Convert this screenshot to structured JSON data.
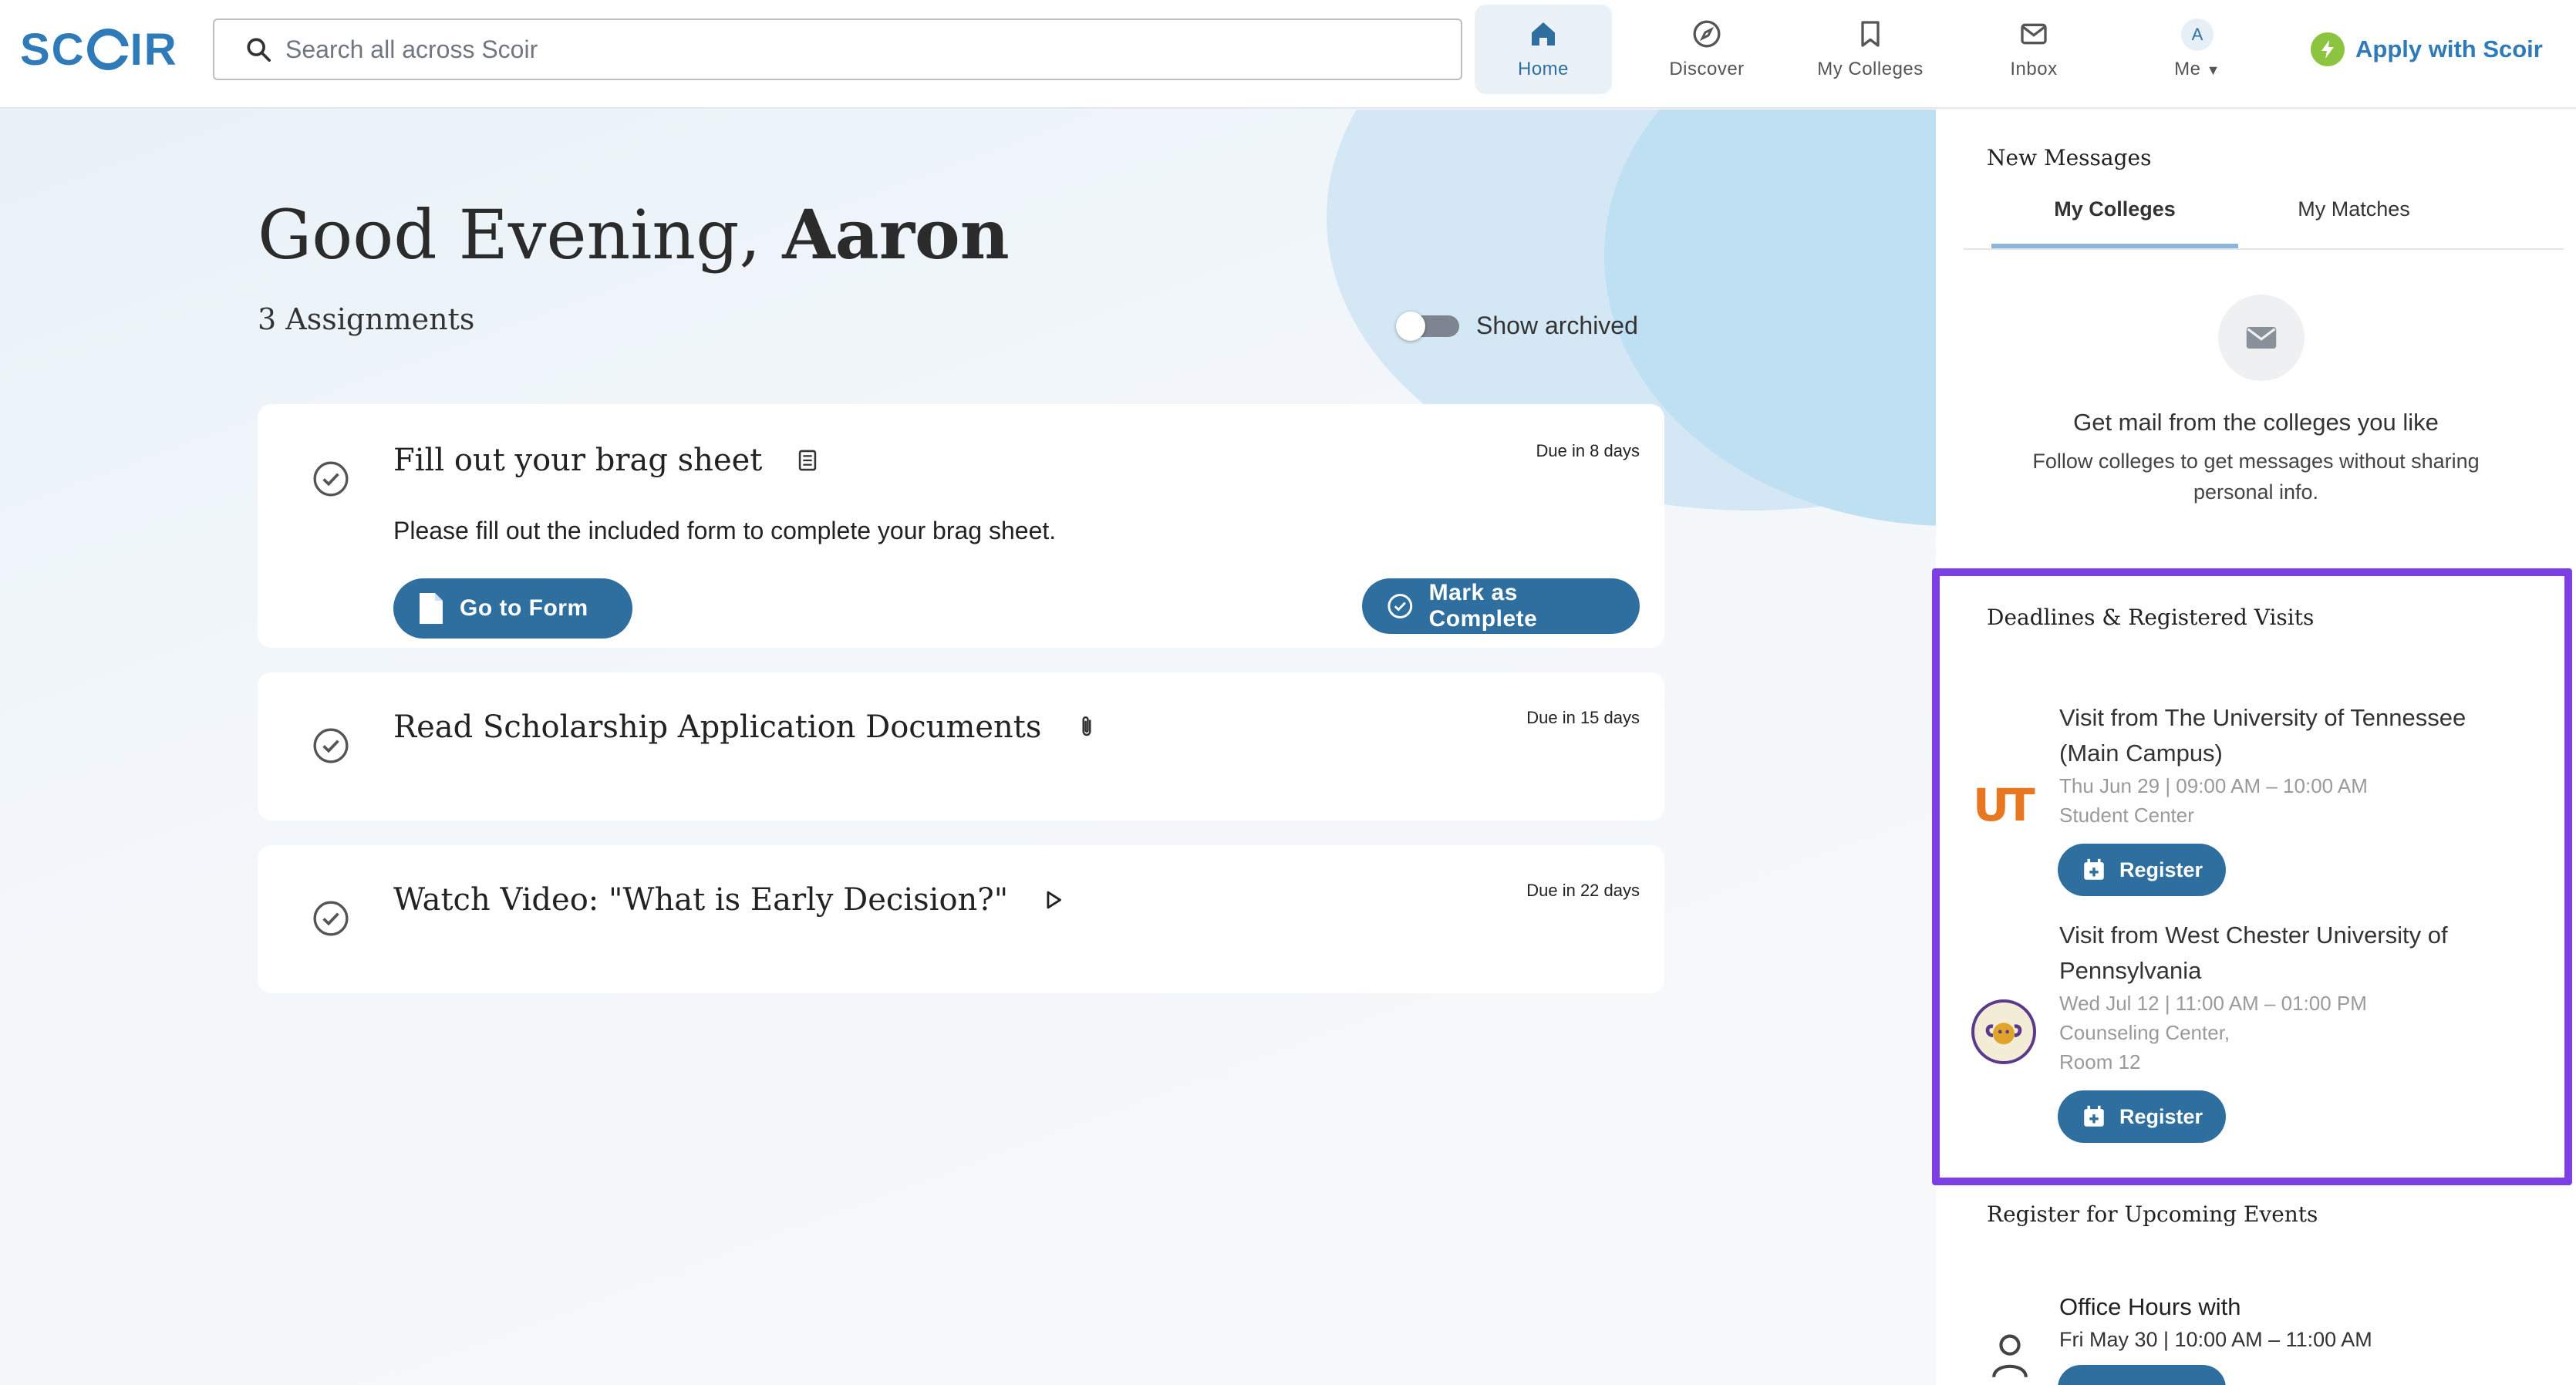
{
  "app": {
    "brand_left": "SC",
    "brand_right": "IR",
    "accent": "#2f6f9f",
    "highlight": "#7c3fe6"
  },
  "search": {
    "placeholder": "Search all across Scoir"
  },
  "nav": {
    "home": "Home",
    "discover": "Discover",
    "my_colleges": "My Colleges",
    "inbox": "Inbox",
    "me": "Me",
    "me_initial": "A",
    "apply": "Apply with Scoir"
  },
  "main": {
    "greeting": "Good Evening,",
    "name": "Aaron",
    "assignment_count": "3 Assignments",
    "show_archived": "Show archived",
    "assignments": [
      {
        "title": "Fill out your brag sheet",
        "icon": "form-icon",
        "due": "Due in 8 days",
        "description": "Please fill out the included form to complete your brag sheet.",
        "primary_button": "Go to Form",
        "secondary_button": "Mark as Complete"
      },
      {
        "title": "Read Scholarship Application Documents",
        "icon": "paperclip-icon",
        "due": "Due in 15 days"
      },
      {
        "title": "Watch Video: \"What is Early Decision?\"",
        "icon": "play-icon",
        "due": "Due in 22 days"
      }
    ]
  },
  "sidebar": {
    "messages_heading": "New Messages",
    "tabs": [
      "My Colleges",
      "My Matches"
    ],
    "empty_title": "Get mail from the colleges you like",
    "empty_subtitle": "Follow colleges to get messages without sharing personal info.",
    "deadlines_heading": "Deadlines & Registered Visits",
    "visits": [
      {
        "logo": "UT",
        "title": "Visit from The University of Tennessee (Main Campus)",
        "datetime": "Thu Jun 29 | 09:00 AM – 10:00 AM",
        "location": "Student Center",
        "button": "Register"
      },
      {
        "title": "Visit from West Chester University of Pennsylvania",
        "datetime": "Wed Jul 12 | 11:00 AM – 01:00 PM",
        "location": "Counseling Center,",
        "location2": "Room 12",
        "button": "Register"
      }
    ],
    "events_heading": "Register for Upcoming Events",
    "events": [
      {
        "title": "Office Hours with",
        "datetime": "Fri May 30 | 10:00 AM – 11:00 AM"
      }
    ]
  }
}
